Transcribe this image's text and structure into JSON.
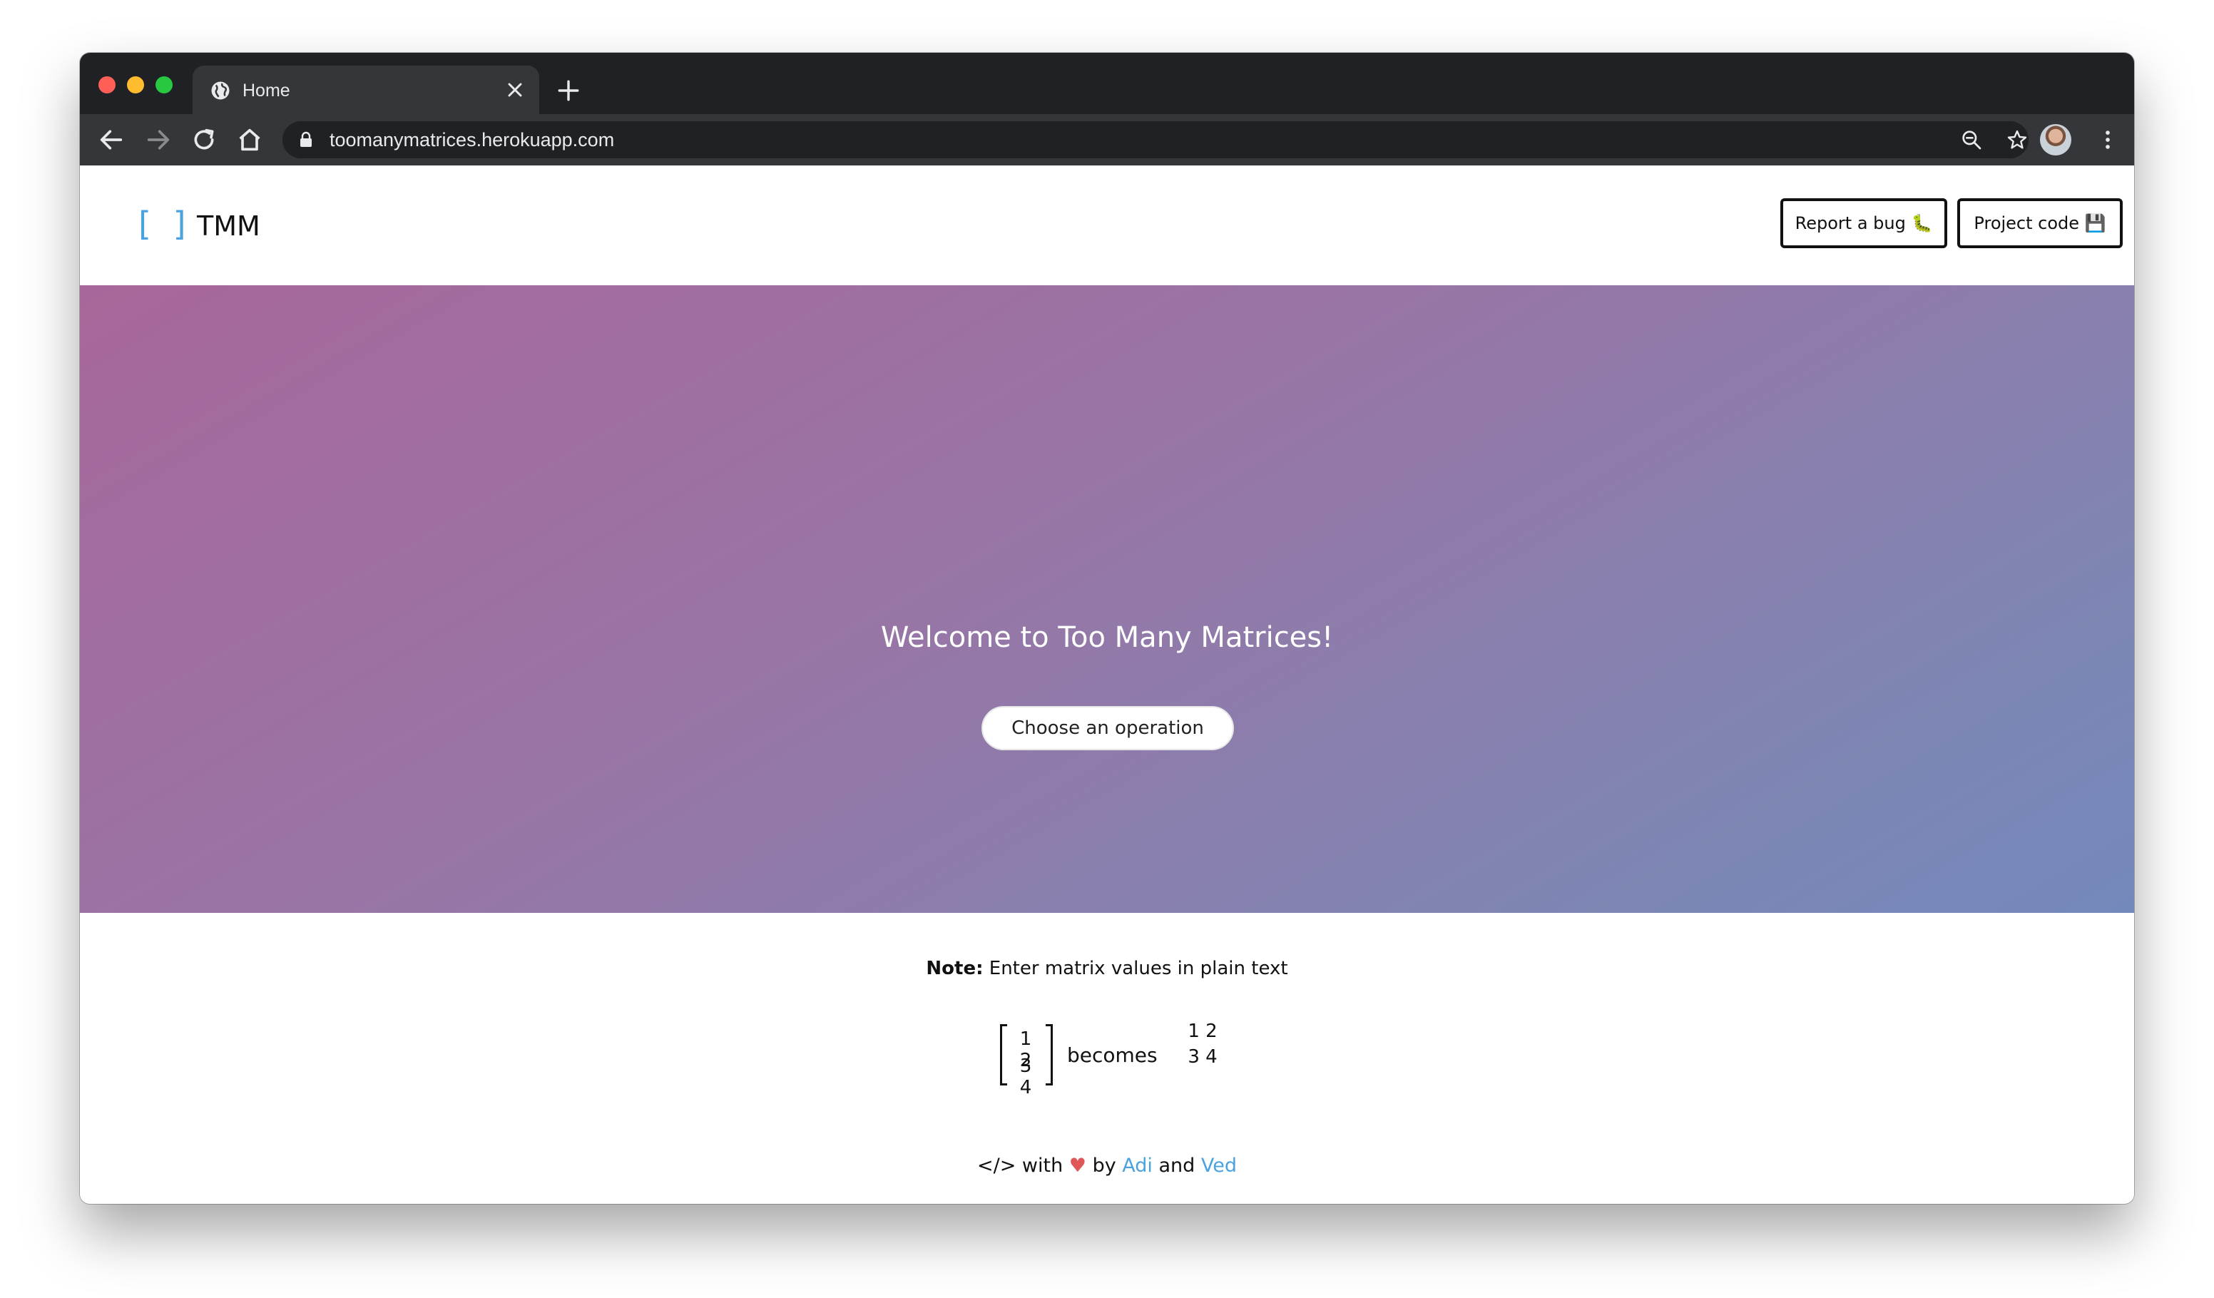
{
  "browser": {
    "tab_title": "Home",
    "url": "toomanymatrices.herokuapp.com"
  },
  "page": {
    "brand": {
      "icon_text": "[ ]",
      "name": "TMM"
    },
    "nav": {
      "report_bug_label": "Report a bug 🐛",
      "project_code_label": "Project code 💾"
    },
    "hero": {
      "title": "Welcome to Too Many Matrices!",
      "cta_label": "Choose an operation"
    },
    "note": {
      "prefix": "Note:",
      "text": " Enter matrix values in plain text"
    },
    "example": {
      "matrix_row1": "1 2",
      "matrix_row2": "3 4",
      "becomes": "becomes",
      "plain_row1": "1 2",
      "plain_row2": "3 4"
    },
    "footer": {
      "code_symbol": "</>",
      "with": " with ",
      "heart": "♥",
      "by": " by ",
      "author1": "Adi",
      "and": " and ",
      "author2": "Ved"
    }
  },
  "colors": {
    "accent": "#4aa3df",
    "hero_gradient_start": "#a8679a",
    "hero_gradient_end": "#7489bb"
  }
}
